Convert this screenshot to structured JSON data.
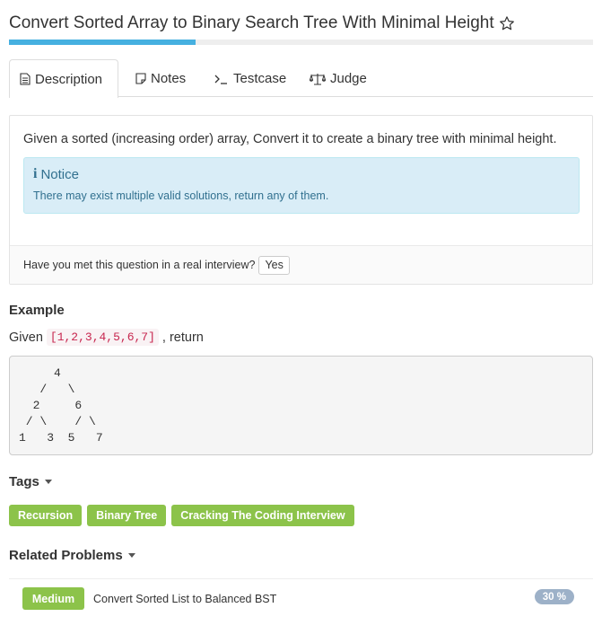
{
  "problem": {
    "title": "Convert Sorted Array to Binary Search Tree With Minimal Height",
    "progress": 0.32
  },
  "tabs": [
    {
      "label": "Description",
      "icon": "document-icon"
    },
    {
      "label": "Notes",
      "icon": "note-icon"
    },
    {
      "label": "Testcase",
      "icon": "terminal-icon"
    },
    {
      "label": "Judge",
      "icon": "scales-icon"
    }
  ],
  "description": {
    "text": "Given a sorted (increasing order) array, Convert it to create a binary tree with minimal height.",
    "notice_icon": "info-icon",
    "notice_title": "Notice",
    "notice_text": "There may exist multiple valid solutions, return any of them.",
    "interview_question": "Have you met this question in a real interview?",
    "yes_label": "Yes"
  },
  "example": {
    "heading": "Example",
    "given_prefix": "Given",
    "given_code": "[1,2,3,4,5,6,7]",
    "given_suffix": ", return",
    "tree_lines": [
      "     4",
      "   /   \\",
      "  2     6",
      " / \\    / \\",
      "1   3  5   7"
    ]
  },
  "tags": {
    "heading": "Tags",
    "items": [
      "Recursion",
      "Binary Tree",
      "Cracking The Coding Interview"
    ]
  },
  "related": {
    "heading": "Related Problems",
    "items": [
      {
        "difficulty": "Medium",
        "name": "Convert Sorted List to Balanced BST",
        "rate": "30 %"
      }
    ]
  },
  "colors": {
    "accent": "#46b0e0",
    "tag_green": "#8cc34a",
    "notice_bg": "#d9edf7",
    "notice_text": "#31708f",
    "code_red": "#c7254e"
  }
}
